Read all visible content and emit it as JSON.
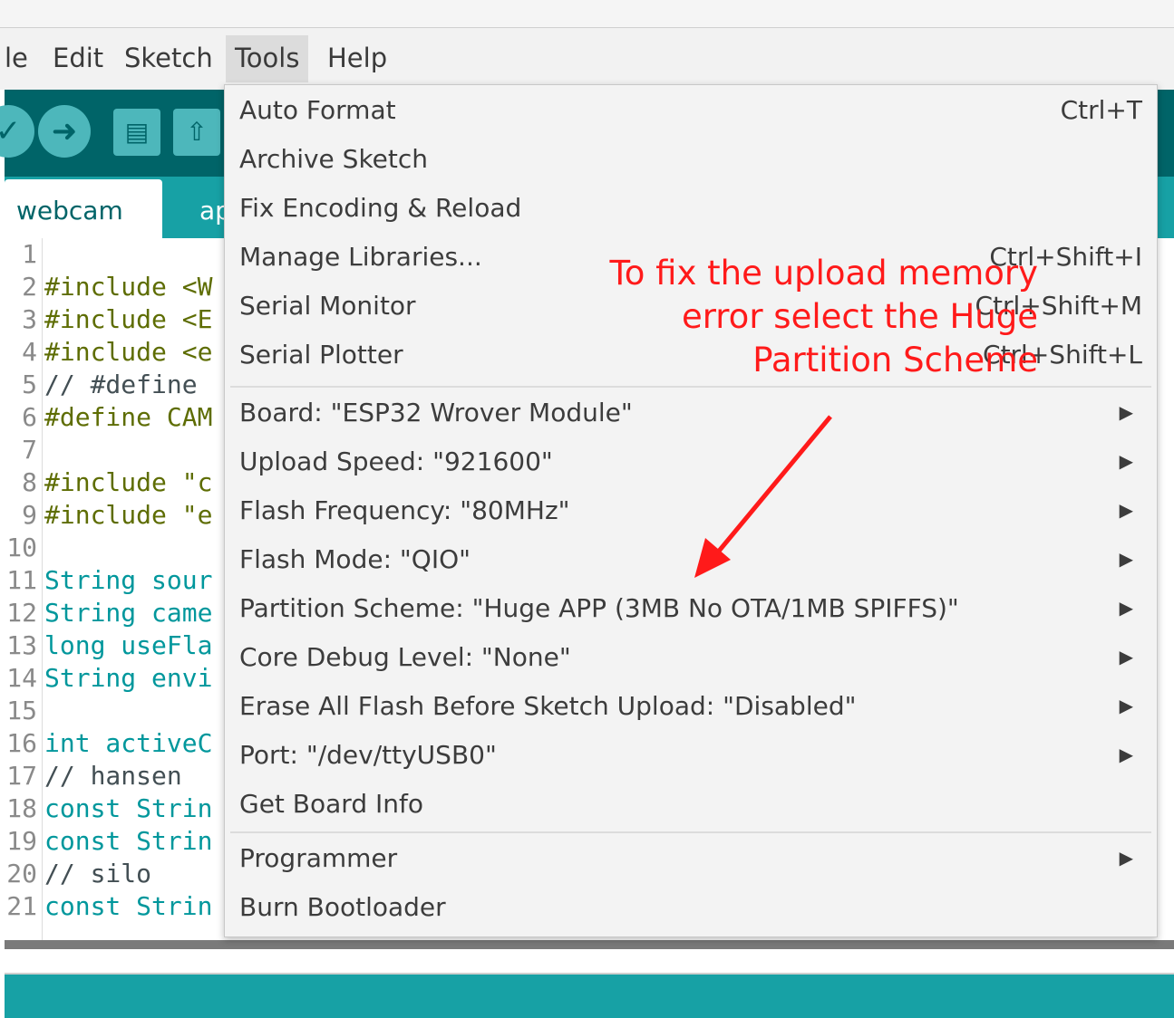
{
  "menubar": {
    "items": [
      "le",
      "Edit",
      "Sketch",
      "Tools",
      "Help"
    ],
    "active": "Tools"
  },
  "tabs": {
    "active_label": "webcam",
    "partial_label": "ap"
  },
  "editor": {
    "lines": [
      {
        "n": "1",
        "text": ""
      },
      {
        "n": "2",
        "text": "#include <W"
      },
      {
        "n": "3",
        "text": "#include <E"
      },
      {
        "n": "4",
        "text": "#include <e"
      },
      {
        "n": "5",
        "text": "// #define"
      },
      {
        "n": "6",
        "text": "#define CAM"
      },
      {
        "n": "7",
        "text": ""
      },
      {
        "n": "8",
        "text": "#include \"c"
      },
      {
        "n": "9",
        "text": "#include \"e"
      },
      {
        "n": "10",
        "text": ""
      },
      {
        "n": "11",
        "text": "String sour"
      },
      {
        "n": "12",
        "text": "String came"
      },
      {
        "n": "13",
        "text": "long useFla"
      },
      {
        "n": "14",
        "text": "String envi"
      },
      {
        "n": "15",
        "text": ""
      },
      {
        "n": "16",
        "text": "int activeC"
      },
      {
        "n": "17",
        "text": "// hansen"
      },
      {
        "n": "18",
        "text": "const Strin"
      },
      {
        "n": "19",
        "text": "const Strin"
      },
      {
        "n": "20",
        "text": "// silo"
      },
      {
        "n": "21",
        "text": "const Strin"
      }
    ]
  },
  "tools_menu": {
    "group1": [
      {
        "label": "Auto Format",
        "shortcut": "Ctrl+T"
      },
      {
        "label": "Archive Sketch",
        "shortcut": ""
      },
      {
        "label": "Fix Encoding & Reload",
        "shortcut": ""
      },
      {
        "label": "Manage Libraries...",
        "shortcut": "Ctrl+Shift+I"
      },
      {
        "label": "Serial Monitor",
        "shortcut": "Ctrl+Shift+M"
      },
      {
        "label": "Serial Plotter",
        "shortcut": "Ctrl+Shift+L"
      }
    ],
    "group2": [
      {
        "label": "Board: \"ESP32 Wrover Module\"",
        "submenu": true
      },
      {
        "label": "Upload Speed: \"921600\"",
        "submenu": true
      },
      {
        "label": "Flash Frequency: \"80MHz\"",
        "submenu": true
      },
      {
        "label": "Flash Mode: \"QIO\"",
        "submenu": true
      },
      {
        "label": "Partition Scheme: \"Huge APP (3MB No OTA/1MB SPIFFS)\"",
        "submenu": true
      },
      {
        "label": "Core Debug Level: \"None\"",
        "submenu": true
      },
      {
        "label": "Erase All Flash Before Sketch Upload: \"Disabled\"",
        "submenu": true
      },
      {
        "label": "Port: \"/dev/ttyUSB0\"",
        "submenu": true
      },
      {
        "label": "Get Board Info",
        "submenu": false
      }
    ],
    "group3": [
      {
        "label": "Programmer",
        "submenu": true
      },
      {
        "label": "Burn Bootloader",
        "submenu": false
      }
    ]
  },
  "annotation": {
    "line1": "To fix the upload memory",
    "line2": "error select the Huge",
    "line3": "Partition Scheme",
    "color": "#ff1a1a"
  },
  "colors": {
    "toolbar": "#006468",
    "tabbar": "#17a1a5",
    "toolbar_button": "#4db7bb"
  }
}
